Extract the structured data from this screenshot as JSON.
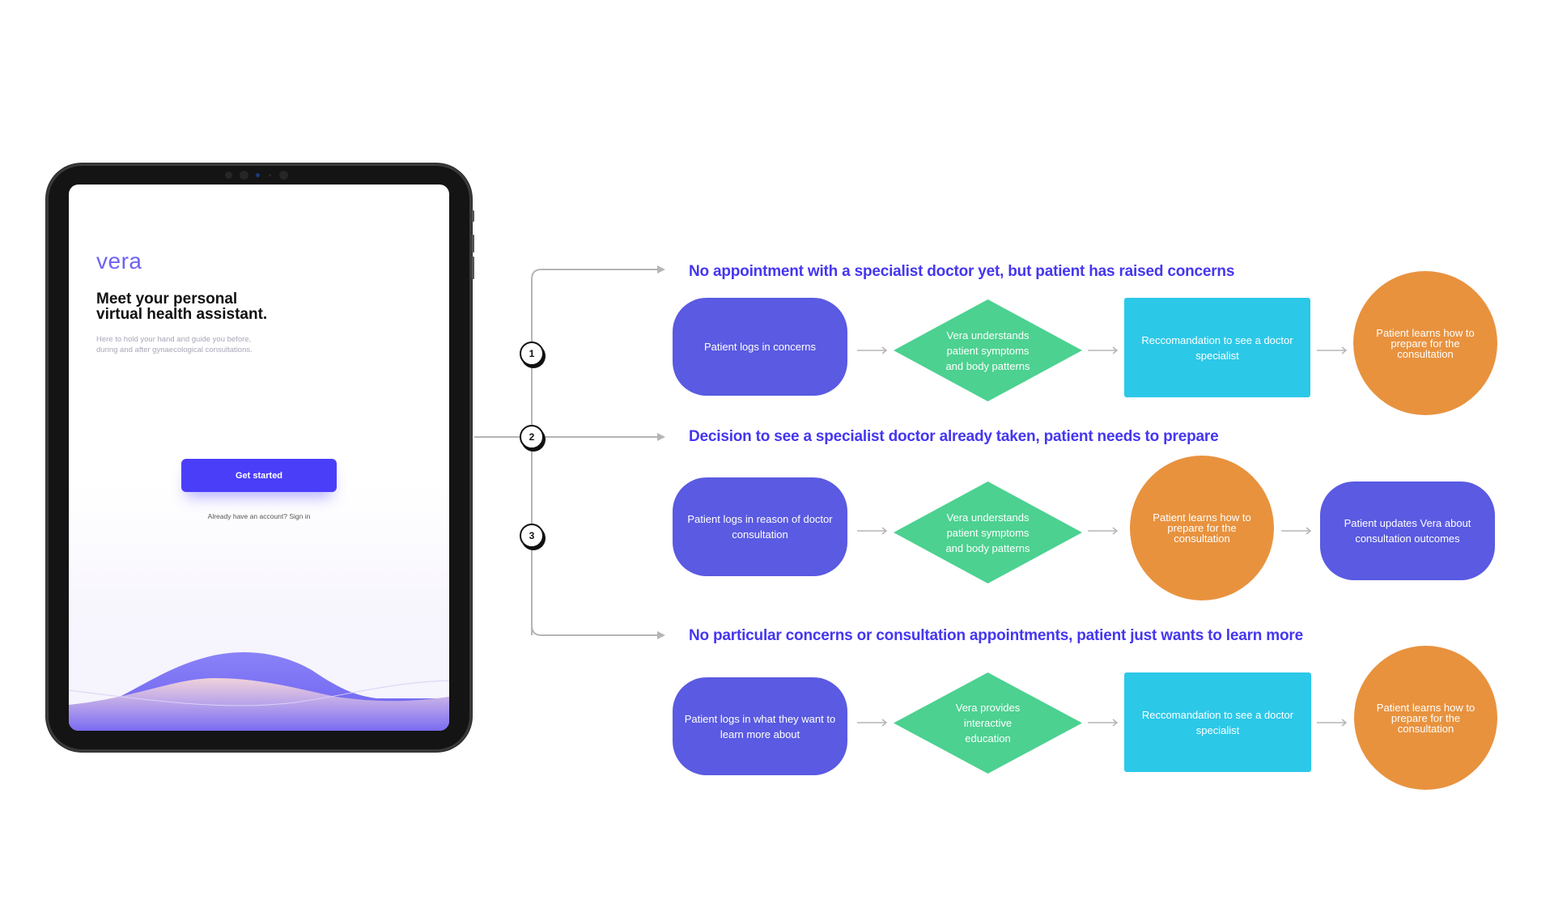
{
  "tablet": {
    "logo": "vera",
    "headline_line1": "Meet your personal",
    "headline_line2": "virtual health assistant.",
    "subtext_line1": "Here to hold your hand and guide you before,",
    "subtext_line2": "during and after gynaecological consultations.",
    "get_started_label": "Get started",
    "signin_text": "Already have an account? Sign in"
  },
  "colors": {
    "title": "#4536f0",
    "pill": "#5a5ae2",
    "diamond": "#4cd190",
    "rect": "#2cc8e8",
    "circle": "#e8923e",
    "brand_button": "#4b3ef9"
  },
  "flows": [
    {
      "badge": "1",
      "title": "No appointment with a specialist doctor yet, but patient has raised concerns",
      "steps": [
        {
          "shape": "pill",
          "text": "Patient logs in concerns"
        },
        {
          "shape": "diamond",
          "text": "Vera understands patient symptoms and body patterns"
        },
        {
          "shape": "rect",
          "text": "Reccomandation to see a doctor specialist"
        },
        {
          "shape": "circle",
          "text": "Patient learns how to prepare for the consultation"
        }
      ]
    },
    {
      "badge": "2",
      "title": "Decision to see a specialist doctor already taken, patient needs to prepare",
      "steps": [
        {
          "shape": "pill",
          "text": "Patient logs in reason of doctor consultation"
        },
        {
          "shape": "diamond",
          "text": "Vera understands patient symptoms and body patterns"
        },
        {
          "shape": "circle",
          "text": "Patient learns how to prepare for the consultation"
        },
        {
          "shape": "pill",
          "text": "Patient updates Vera about consultation outcomes"
        }
      ]
    },
    {
      "badge": "3",
      "title": "No particular concerns or consultation appointments, patient just wants to learn more",
      "steps": [
        {
          "shape": "pill",
          "text": "Patient logs in what they want to learn more about"
        },
        {
          "shape": "diamond",
          "text": "Vera provides interactive education"
        },
        {
          "shape": "rect",
          "text": "Reccomandation to see a doctor specialist"
        },
        {
          "shape": "circle",
          "text": "Patient learns how to prepare for the consultation"
        }
      ]
    }
  ]
}
